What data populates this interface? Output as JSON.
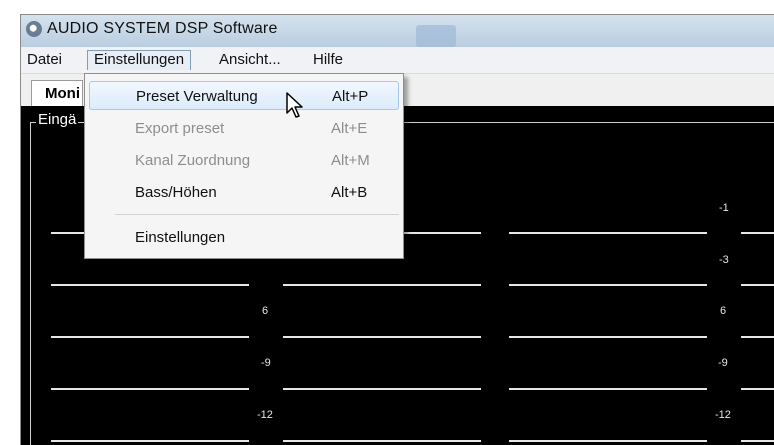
{
  "window": {
    "title": "AUDIO SYSTEM DSP Software",
    "icon": "speaker-icon"
  },
  "menubar": {
    "items": [
      "Datei",
      "Einstellungen",
      "Ansicht...",
      "Hilfe"
    ],
    "active": "Einstellungen"
  },
  "tabs": {
    "monitor_label": "Moni"
  },
  "monitor": {
    "group_label": "Eingä",
    "left_values": [
      "6",
      "-9",
      "-12"
    ],
    "right_values": [
      "-1",
      "-3",
      "6",
      "-9",
      "-12"
    ]
  },
  "dropdown": {
    "items": [
      {
        "label": "Preset Verwaltung",
        "shortcut": "Alt+P",
        "enabled": true,
        "hovered": true
      },
      {
        "label": "Export preset",
        "shortcut": "Alt+E",
        "enabled": false
      },
      {
        "label": "Kanal Zuordnung",
        "shortcut": "Alt+M",
        "enabled": false
      },
      {
        "label": "Bass/Höhen",
        "shortcut": "Alt+B",
        "enabled": true
      },
      {
        "label": "Einstellungen",
        "shortcut": "",
        "enabled": true
      }
    ]
  },
  "cursor": {
    "icon": "arrow-pointer-icon"
  }
}
